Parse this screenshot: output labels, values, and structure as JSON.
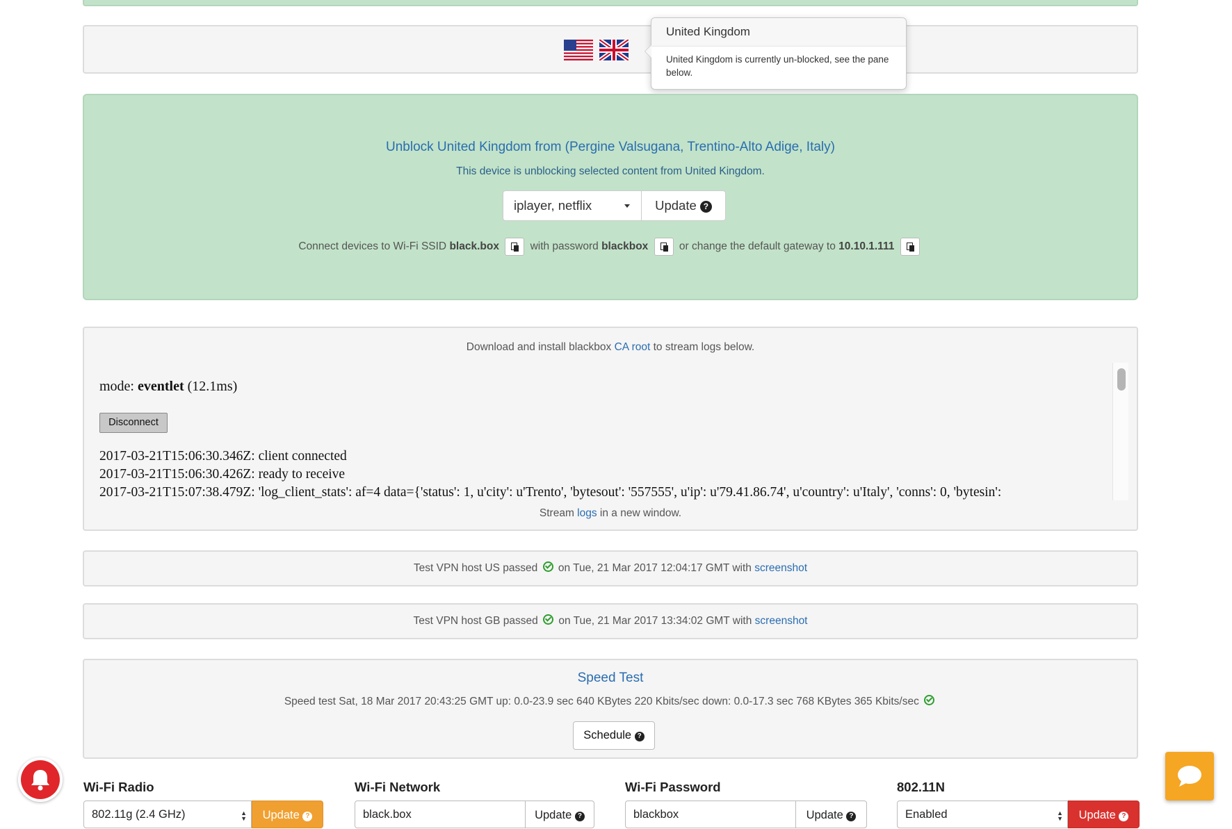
{
  "tooltip": {
    "title": "United Kingdom",
    "body": "United Kingdom is currently un-blocked, see the pane below."
  },
  "unblock": {
    "title": "Unblock United Kingdom from (Pergine Valsugana, Trentino-Alto Adige, Italy)",
    "subtitle": "This device is unblocking selected content from United Kingdom.",
    "select_value": "iplayer, netflix",
    "update_label": "Update",
    "connect_prefix": "Connect devices to Wi-Fi SSID",
    "ssid": "black.box",
    "password_prefix": "with password",
    "password": "blackbox",
    "gateway_prefix": "or change the default gateway to",
    "gateway": "10.10.1.111"
  },
  "logs": {
    "download_prefix": "Download and install blackbox",
    "ca_link": "CA root",
    "download_suffix": "to stream logs below.",
    "mode_prefix": "mode:",
    "mode_value": "eventlet",
    "mode_time": "(12.1ms)",
    "disconnect_label": "Disconnect",
    "lines": [
      "2017-03-21T15:06:30.346Z: client connected",
      "2017-03-21T15:06:30.426Z: ready to receive",
      "2017-03-21T15:07:38.479Z: 'log_client_stats': af=4 data={'status': 1, u'city': u'Trento', 'bytesout': '557555', u'ip': u'79.41.86.74', u'country': u'Italy', 'conns': 0, 'bytesin':"
    ],
    "stream_prefix": "Stream",
    "stream_link": "logs",
    "stream_suffix": "in a new window."
  },
  "vpn_tests": [
    {
      "text": "Test VPN host US passed",
      "date": "on Tue, 21 Mar 2017 12:04:17 GMT with",
      "link": "screenshot"
    },
    {
      "text": "Test VPN host GB passed",
      "date": "on Tue, 21 Mar 2017 13:34:02 GMT with",
      "link": "screenshot"
    }
  ],
  "speed": {
    "title": "Speed Test",
    "text": "Speed test Sat, 18 Mar 2017 20:43:25 GMT up: 0.0-23.9 sec 640 KBytes 220 Kbits/sec down: 0.0-17.3 sec 768 KBytes 365 Kbits/sec",
    "schedule_label": "Schedule"
  },
  "settings": [
    {
      "label": "Wi-Fi Radio",
      "value": "802.11g (2.4 GHz)",
      "button": "Update",
      "color": "#f0a030"
    },
    {
      "label": "Wi-Fi Network",
      "value": "black.box",
      "button": "Update",
      "color": "#ffffff"
    },
    {
      "label": "Wi-Fi Password",
      "value": "blackbox",
      "button": "Update",
      "color": "#ffffff"
    },
    {
      "label": "802.11N",
      "value": "Enabled",
      "button": "Update",
      "color": "#d9322e"
    }
  ],
  "icons": {
    "us_flag": "us-flag-icon",
    "uk_flag": "uk-flag-icon",
    "help": "question-circle-icon",
    "copy": "copy-icon",
    "check": "check-circle-icon",
    "notification": "bell-icon",
    "chat": "chat-bubble-icon"
  }
}
